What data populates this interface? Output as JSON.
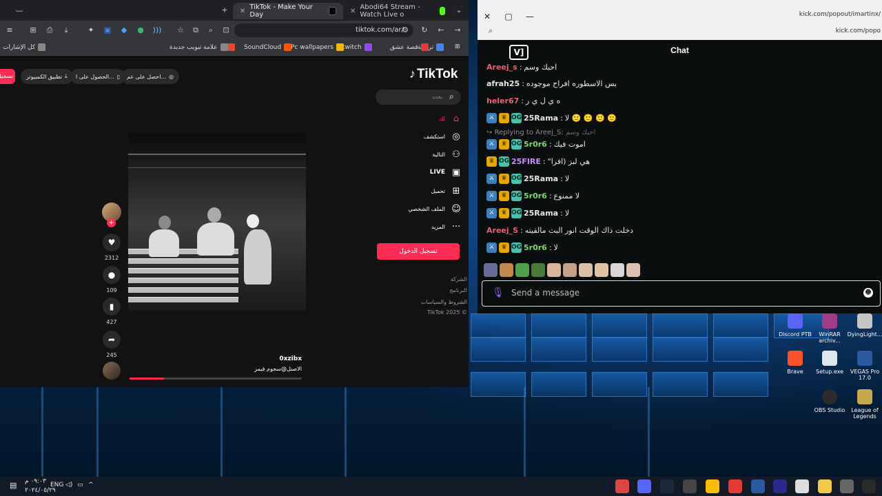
{
  "browser": {
    "tabs": [
      {
        "title": "TikTok - Make Your Day",
        "favicon_color": "#000000"
      },
      {
        "title": "Abodi64 Stream - Watch Live o",
        "favicon_color": "#53fc18"
      }
    ],
    "new_tab": "+",
    "url": "tiktok.com/ar/",
    "bookmarks": [
      {
        "label": "ترجمة",
        "color": "#4285f4"
      },
      {
        "label": "قصة عشق",
        "color": "#e53935"
      },
      {
        "label": "twitch",
        "color": "#9146ff"
      },
      {
        "label": "Pc wallpapers",
        "color": "#f2b800"
      },
      {
        "label": "SoundCloud",
        "color": "#ff5500"
      },
      {
        "label": "Gmail",
        "color": "#ea4335"
      },
      {
        "label": "علامة تبويب جديدة",
        "color": "#888888"
      },
      {
        "label": "كل الإشارات",
        "color": "#888888"
      }
    ]
  },
  "tiktok": {
    "logo": "TikTok",
    "top_pills": [
      "احصل على عم...",
      "الحصول على ا...",
      "تطبيق الكمبيوتر"
    ],
    "login_small": "تسجيل",
    "search_placeholder": "بحث",
    "nav": [
      {
        "label": "لك",
        "icon": "⌂",
        "active": true
      },
      {
        "label": "استكشف",
        "icon": "◎"
      },
      {
        "label": "التالية",
        "icon": "⚇"
      },
      {
        "label": "LIVE",
        "icon": "▣"
      },
      {
        "label": "تحميل",
        "icon": "⊞"
      },
      {
        "label": "الملف الشخصي",
        "icon": "☺"
      },
      {
        "label": "المزيد",
        "icon": "···"
      }
    ],
    "login_button": "تسجيل الدخول",
    "footer": [
      "الشركة",
      "البرنامج",
      "الشروط والسياسات",
      "TikTok 2025 ©"
    ],
    "counts": {
      "likes": "2312",
      "comments": "109",
      "saves": "427",
      "shares": "245"
    },
    "author": "0xzibx",
    "description": "الاصنل@سجوم فيمز",
    "progress": 0.2
  },
  "chat": {
    "url_top": "kick.com/popout/imartinx/",
    "url_second": "kick.com/popo",
    "title": "Chat",
    "messages": [
      {
        "user": "Areej_s",
        "color": "#e8616f",
        "text": "احبك وسم",
        "badges": []
      },
      {
        "user": "afrah25",
        "color": "#e6e6e6",
        "text": "بس الاسطوره افراح موجوده",
        "badges": []
      },
      {
        "user": "heler67",
        "color": "#e8616f",
        "text": "ه ي ل ي ر",
        "badges": []
      },
      {
        "user": "25Rama",
        "color": "#e6e6e6",
        "text": "لا 🙂 🙂 🙂 🙂",
        "badges": [
          "mod",
          "crown",
          "og"
        ]
      },
      {
        "user": "5r0r6",
        "color": "#7cd66b",
        "text": "اموت فيك",
        "badges": [
          "mod",
          "crown",
          "og"
        ]
      },
      {
        "user": "25FIRE",
        "color": "#c98bff",
        "text": "\"هي لبز (افرا",
        "badges": [
          "crown",
          "og"
        ]
      },
      {
        "user": "25Rama",
        "color": "#e6e6e6",
        "text": "لا",
        "badges": [
          "mod",
          "crown",
          "og"
        ]
      },
      {
        "user": "5r0r6",
        "color": "#7cd66b",
        "text": "لا ممنوع",
        "badges": [
          "mod",
          "crown",
          "og"
        ]
      },
      {
        "user": "25Rama",
        "color": "#e6e6e6",
        "text": "لا",
        "badges": [
          "mod",
          "crown",
          "og"
        ]
      },
      {
        "user": "Areej_S",
        "color": "#e8616f",
        "text": "دخلت ذاك الوقت انور البث مالقيته",
        "badges": []
      },
      {
        "user": "5r0r6",
        "color": "#7cd66b",
        "text": "لا",
        "badges": [
          "mod",
          "crown",
          "og"
        ]
      }
    ],
    "reply_hint": "Replying to Areej_S:",
    "reply_quote": "احبك وسم",
    "emote_colors": [
      "#6b6b9a",
      "#c0884d",
      "#4fa04a",
      "#4a7a3a",
      "#d9b69a",
      "#c7a08a",
      "#d9c1a6",
      "#e3c2a2",
      "#d8d8d8",
      "#e0c0b0"
    ],
    "input_placeholder": "Send a message"
  },
  "desktop_icons": [
    {
      "label": "Discord PTB",
      "color": "#5865f2"
    },
    {
      "label": "WinRAR archiv...",
      "color": "#a03c8a"
    },
    {
      "label": "DyingLight...",
      "color": "#c5c5c5"
    },
    {
      "label": "Brave",
      "color": "#fb542b"
    },
    {
      "label": "Setup.exe",
      "color": "#dfe6ee"
    },
    {
      "label": "VEGAS Pro 17.0",
      "color": "#2b5aa0"
    },
    {
      "label": "OBS Studio",
      "color": "#2b2b2b"
    },
    {
      "label": "League of Legends",
      "color": "#c8a84e"
    }
  ],
  "taskbar": {
    "time": "٠٩:٠٣ م",
    "date": "٢٠٢٤/٠٥/٢٩",
    "lang": "ENG",
    "icon_colors": [
      "#d44",
      "#5865f2",
      "#1b2838",
      "#444",
      "#fbbc05",
      "#e53935",
      "#2b5aa0",
      "#2a2a8a",
      "#dddddd",
      "#f2c94c",
      "#666",
      "#2a2a2a"
    ]
  }
}
